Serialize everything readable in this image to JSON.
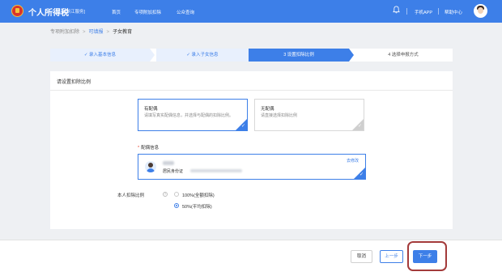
{
  "header": {
    "brand": "个人所得税",
    "region": "[浙江服务]",
    "nav": [
      "首页",
      "专项附加扣除",
      "公众查询"
    ],
    "mobile_app": "手机APP",
    "help_center": "帮助中心"
  },
  "breadcrumb": [
    "专项附加扣除",
    "可填报",
    "子女教育"
  ],
  "steps": [
    {
      "label": "✓ 录入基本信息",
      "state": "done"
    },
    {
      "label": "✓ 录入子女信息",
      "state": "done"
    },
    {
      "label": "3 设置扣除比例",
      "state": "current"
    },
    {
      "label": "4 选择申报方式",
      "state": "todo"
    }
  ],
  "card": {
    "title": "请设置扣除比例",
    "options": [
      {
        "title": "有配偶",
        "desc": "请填写真实配偶信息，并选择与配偶的扣除比例。",
        "selected": true
      },
      {
        "title": "无配偶",
        "desc": "请直接选择扣除比例",
        "selected": false
      }
    ],
    "spouse_label": "配偶信息",
    "spouse_required_mark": "*",
    "spouse_id_type": "居民身份证",
    "modify_link": "去修改",
    "ratio_label": "本人扣除比例",
    "ratio_help": "?",
    "ratio_options": [
      {
        "label": "100%(全额扣除)",
        "selected": false
      },
      {
        "label": "50%(平均扣除)",
        "selected": true
      }
    ]
  },
  "footer": {
    "cancel": "取消",
    "prev": "上一步",
    "next": "下一步"
  },
  "colors": {
    "primary": "#3d7fe8",
    "highlight_box": "#a33a3a",
    "background": "#eef0f3"
  },
  "icons": [
    "tax-emblem-icon",
    "bell-icon",
    "user-avatar",
    "check-icon",
    "help-icon",
    "person-avatar"
  ]
}
